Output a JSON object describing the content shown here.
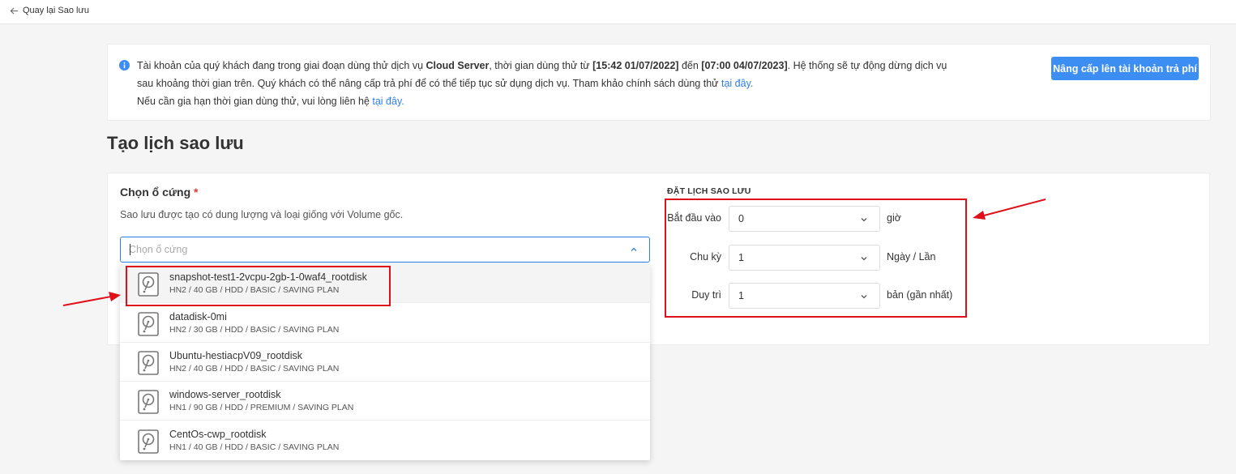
{
  "nav": {
    "back_label": "Quay lại Sao lưu"
  },
  "notice": {
    "line1_a": "Tài khoản của quý khách đang trong giai đoạn dùng thử dịch vụ ",
    "service": "Cloud Server",
    "line1_b": ", thời gian dùng thử từ ",
    "start": "[15:42 01/07/2022]",
    "line1_c": " đến ",
    "end": "[07:00 04/07/2023]",
    "line1_d": ". Hệ thống sẽ tự động dừng dịch vụ sau khoảng thời gian trên. Quý khách có thể nâng cấp trả phí để có thể tiếp tục sử dụng dịch vụ. Tham khảo chính sách dùng thử ",
    "policy_link": "tại đây.",
    "line2": "Nếu cần gia hạn thời gian dùng thử, vui lòng liên hệ ",
    "contact_link": "tại đây.",
    "upgrade_button": "Nâng cấp lên tài khoản trả phí"
  },
  "page_title": "Tạo lịch sao lưu",
  "disk": {
    "label": "Chọn ổ cứng",
    "required_mark": "*",
    "description": "Sao lưu được tạo có dung lượng và loại giống với Volume gốc.",
    "placeholder": "Chọn ổ cứng",
    "options": [
      {
        "name": "snapshot-test1-2vcpu-2gb-1-0waf4_rootdisk",
        "meta": "HN2 / 40 GB / HDD / BASIC / SAVING PLAN"
      },
      {
        "name": "datadisk-0mi",
        "meta": "HN2 / 30 GB / HDD / BASIC / SAVING PLAN"
      },
      {
        "name": "Ubuntu-hestiacpV09_rootdisk",
        "meta": "HN2 / 40 GB / HDD / BASIC / SAVING PLAN"
      },
      {
        "name": "windows-server_rootdisk",
        "meta": "HN1 / 90 GB / HDD / PREMIUM / SAVING PLAN"
      },
      {
        "name": "CentOs-cwp_rootdisk",
        "meta": "HN1 / 40 GB / HDD / BASIC / SAVING PLAN"
      }
    ]
  },
  "schedule": {
    "title": "ĐẶT LỊCH SAO LƯU",
    "start": {
      "label": "Bắt đầu vào",
      "value": "0",
      "unit": "giờ"
    },
    "cycle": {
      "label": "Chu kỳ",
      "value": "1",
      "unit": "Ngày / Lần"
    },
    "retain": {
      "label": "Duy trì",
      "value": "1",
      "unit": "bản (gần nhất)"
    }
  },
  "colors": {
    "primary": "#3d8ef2",
    "link": "#2f7ee8",
    "highlight": "#e0101a"
  }
}
